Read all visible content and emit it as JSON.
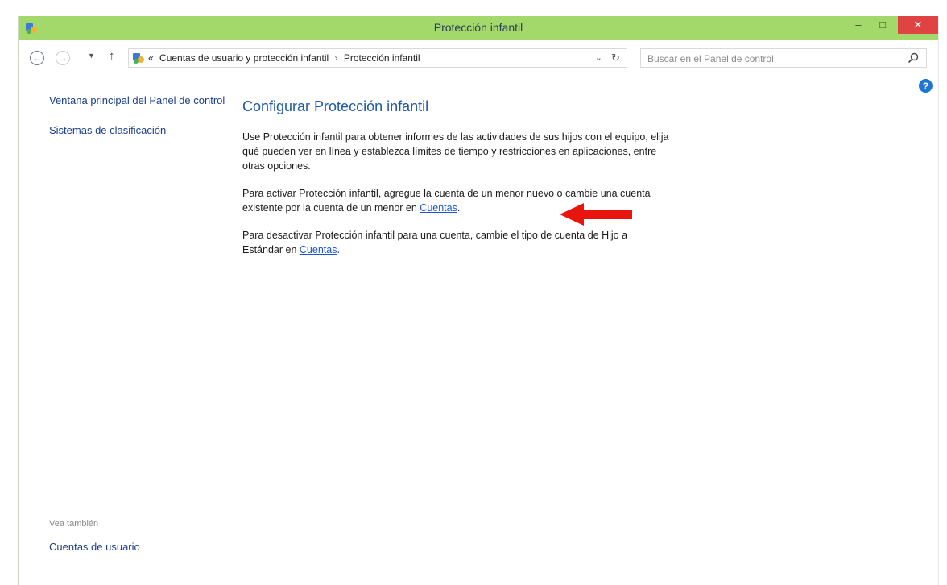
{
  "window": {
    "title": "Protección infantil",
    "controls": {
      "minimize": "–",
      "maximize": "□",
      "close": "✕"
    },
    "accent_color": "#a3d86a",
    "close_color": "#e04343"
  },
  "nav": {
    "breadcrumb": {
      "prefix": "«",
      "items": [
        "Cuentas de usuario y protección infantil",
        "Protección infantil"
      ],
      "separator": "›"
    },
    "search": {
      "placeholder": "Buscar en el Panel de control"
    }
  },
  "sidebar": {
    "items": [
      {
        "label": "Ventana principal del Panel de control"
      },
      {
        "label": "Sistemas de clasificación"
      }
    ],
    "see_also": {
      "title": "Vea también",
      "items": [
        {
          "label": "Cuentas de usuario"
        }
      ]
    }
  },
  "main": {
    "heading": "Configurar Protección infantil",
    "paragraph1": "Use Protección infantil para obtener informes de las actividades de sus hijos con el equipo, elija qué pueden ver en línea y establezca límites de tiempo y restricciones en aplicaciones, entre otras opciones.",
    "paragraph2": {
      "text": "Para activar Protección infantil, agregue la cuenta de un menor nuevo o cambie una cuenta existente por la cuenta de un menor en ",
      "link": "Cuentas",
      "end": "."
    },
    "paragraph3": {
      "text": "Para desactivar Protección infantil para una cuenta, cambie el tipo de cuenta de Hijo a Estándar en ",
      "link": "Cuentas",
      "end": "."
    }
  },
  "icons": {
    "app": "control-panel-icon",
    "back": "back-arrow-icon",
    "forward": "forward-arrow-icon",
    "up": "up-arrow-icon",
    "refresh": "refresh-icon",
    "search": "search-icon",
    "help": "help-icon",
    "annotation": "red-arrow-annotation"
  }
}
